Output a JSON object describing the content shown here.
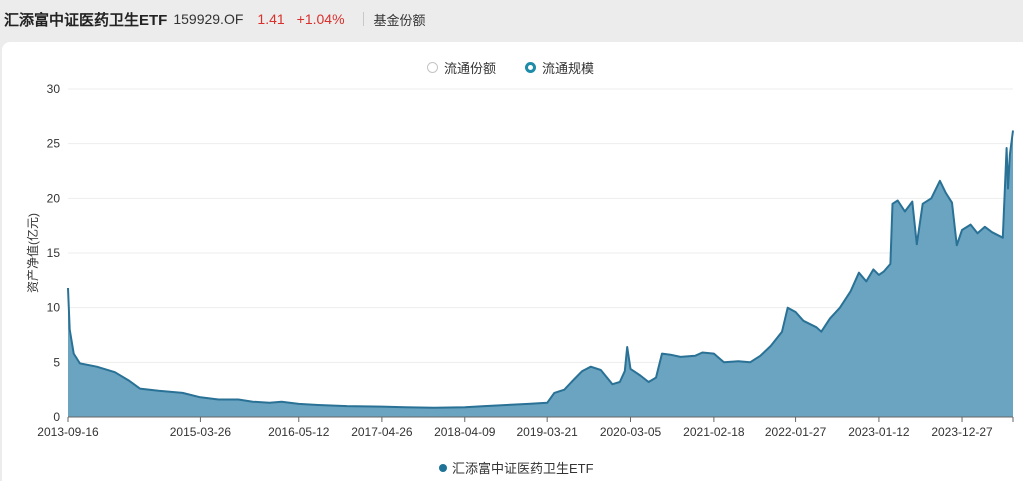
{
  "header": {
    "fund_name": "汇添富中证医药卫生ETF",
    "fund_code": "159929.OF",
    "price": "1.41",
    "change": "+1.04%",
    "metric_label": "基金份额"
  },
  "toggles": [
    {
      "label": "流通份额",
      "selected": false
    },
    {
      "label": "流通规模",
      "selected": true
    }
  ],
  "colors": {
    "line": "#2a7196",
    "fill": "#6aa4c1",
    "accent": "#1c8ca8",
    "up": "#d9302c"
  },
  "chart_data": {
    "type": "area",
    "title": "",
    "xlabel": "",
    "ylabel": "资产净值(亿元)",
    "ylim": [
      0,
      30
    ],
    "yticks": [
      0,
      5,
      10,
      15,
      20,
      25,
      30
    ],
    "xticks": [
      "2013-09-16",
      "2015-03-26",
      "2016-05-12",
      "2017-04-26",
      "2018-04-09",
      "2019-03-21",
      "2020-03-05",
      "2021-02-18",
      "2022-01-27",
      "2023-01-12",
      "2023-12-27"
    ],
    "grid": true,
    "legend_position": "bottom",
    "series": [
      {
        "name": "汇添富中证医药卫生ETF",
        "points": [
          [
            "2013-09-16",
            11.8
          ],
          [
            "2013-09-23",
            8.0
          ],
          [
            "2013-10-10",
            5.8
          ],
          [
            "2013-11-05",
            4.9
          ],
          [
            "2014-01-15",
            4.6
          ],
          [
            "2014-04-01",
            4.1
          ],
          [
            "2014-06-01",
            3.3
          ],
          [
            "2014-07-15",
            2.6
          ],
          [
            "2014-10-01",
            2.4
          ],
          [
            "2015-01-10",
            2.2
          ],
          [
            "2015-03-26",
            1.8
          ],
          [
            "2015-06-10",
            1.6
          ],
          [
            "2015-09-01",
            1.6
          ],
          [
            "2015-11-01",
            1.4
          ],
          [
            "2016-01-10",
            1.3
          ],
          [
            "2016-03-01",
            1.4
          ],
          [
            "2016-05-12",
            1.2
          ],
          [
            "2016-08-01",
            1.1
          ],
          [
            "2016-12-01",
            1.0
          ],
          [
            "2017-04-26",
            0.95
          ],
          [
            "2017-08-01",
            0.9
          ],
          [
            "2017-12-01",
            0.85
          ],
          [
            "2018-04-09",
            0.9
          ],
          [
            "2018-07-01",
            1.0
          ],
          [
            "2018-10-01",
            1.1
          ],
          [
            "2019-01-01",
            1.2
          ],
          [
            "2019-03-21",
            1.3
          ],
          [
            "2019-04-20",
            2.2
          ],
          [
            "2019-06-01",
            2.5
          ],
          [
            "2019-07-01",
            3.2
          ],
          [
            "2019-08-15",
            4.2
          ],
          [
            "2019-09-20",
            4.6
          ],
          [
            "2019-11-01",
            4.3
          ],
          [
            "2019-12-20",
            3.0
          ],
          [
            "2020-01-20",
            3.2
          ],
          [
            "2020-02-10",
            4.2
          ],
          [
            "2020-02-20",
            6.4
          ],
          [
            "2020-03-05",
            4.4
          ],
          [
            "2020-04-15",
            3.8
          ],
          [
            "2020-05-20",
            3.2
          ],
          [
            "2020-06-20",
            3.6
          ],
          [
            "2020-07-15",
            5.8
          ],
          [
            "2020-08-20",
            5.7
          ],
          [
            "2020-10-01",
            5.5
          ],
          [
            "2020-12-01",
            5.6
          ],
          [
            "2021-01-01",
            5.9
          ],
          [
            "2021-02-18",
            5.8
          ],
          [
            "2021-04-01",
            5.0
          ],
          [
            "2021-06-01",
            5.1
          ],
          [
            "2021-07-20",
            5.0
          ],
          [
            "2021-09-01",
            5.6
          ],
          [
            "2021-10-15",
            6.5
          ],
          [
            "2021-12-01",
            7.8
          ],
          [
            "2021-12-25",
            10.0
          ],
          [
            "2022-01-27",
            9.6
          ],
          [
            "2022-03-01",
            8.8
          ],
          [
            "2022-04-25",
            8.2
          ],
          [
            "2022-05-15",
            7.8
          ],
          [
            "2022-06-20",
            9.0
          ],
          [
            "2022-08-01",
            10.0
          ],
          [
            "2022-09-15",
            11.5
          ],
          [
            "2022-10-20",
            13.2
          ],
          [
            "2022-11-20",
            12.4
          ],
          [
            "2022-12-20",
            13.5
          ],
          [
            "2023-01-12",
            13.0
          ],
          [
            "2023-02-01",
            13.3
          ],
          [
            "2023-03-01",
            14.0
          ],
          [
            "2023-03-10",
            19.5
          ],
          [
            "2023-04-01",
            19.8
          ],
          [
            "2023-05-01",
            18.8
          ],
          [
            "2023-06-01",
            19.7
          ],
          [
            "2023-06-20",
            15.8
          ],
          [
            "2023-07-15",
            19.5
          ],
          [
            "2023-08-20",
            20.0
          ],
          [
            "2023-09-25",
            21.6
          ],
          [
            "2023-10-20",
            20.5
          ],
          [
            "2023-11-15",
            19.6
          ],
          [
            "2023-12-05",
            15.7
          ],
          [
            "2023-12-27",
            17.1
          ],
          [
            "2024-02-01",
            17.6
          ],
          [
            "2024-03-01",
            16.8
          ],
          [
            "2024-04-01",
            17.4
          ],
          [
            "2024-05-01",
            16.9
          ],
          [
            "2024-06-15",
            16.4
          ],
          [
            "2024-07-01",
            24.6
          ],
          [
            "2024-07-07",
            20.9
          ],
          [
            "2024-07-15",
            24.0
          ],
          [
            "2024-07-28",
            26.2
          ]
        ]
      }
    ]
  }
}
